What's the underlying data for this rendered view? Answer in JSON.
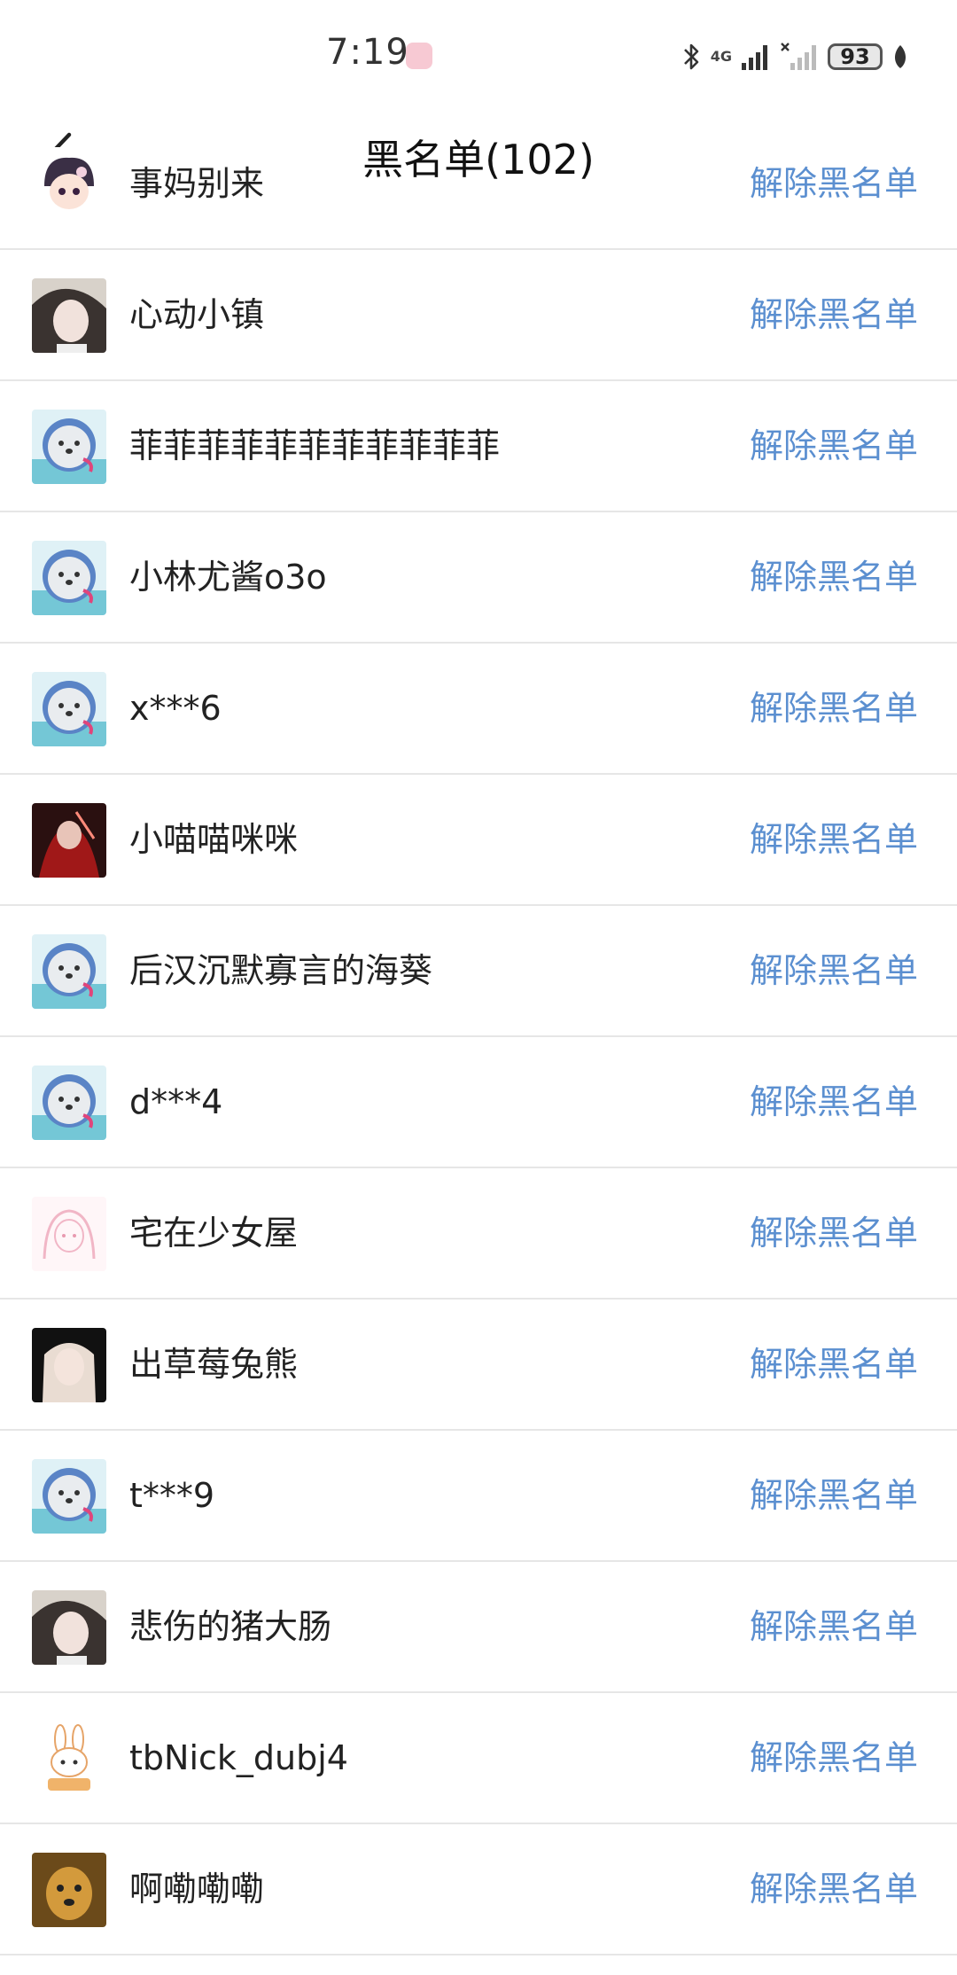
{
  "status_bar": {
    "time": "7:19",
    "network": "4G",
    "battery": "93"
  },
  "header": {
    "title": "黑名单(102)"
  },
  "action_label": "解除黑名单",
  "colors": {
    "link": "#5b8fd0",
    "divider": "#e6e6e6"
  },
  "users": [
    {
      "name": "事妈别来",
      "avatar": "anime-avatar"
    },
    {
      "name": "心动小镇",
      "avatar": "photo-avatar"
    },
    {
      "name": "菲菲菲菲菲菲菲菲菲菲菲",
      "avatar": "default-seal-avatar"
    },
    {
      "name": "小林尤酱o3o",
      "avatar": "default-seal-avatar"
    },
    {
      "name": "x***6",
      "avatar": "default-seal-avatar"
    },
    {
      "name": "小喵喵咪咪",
      "avatar": "red-art-avatar"
    },
    {
      "name": "后汉沉默寡言的海葵",
      "avatar": "default-seal-avatar"
    },
    {
      "name": "d***4",
      "avatar": "default-seal-avatar"
    },
    {
      "name": "宅在少女屋",
      "avatar": "pink-sketch-avatar"
    },
    {
      "name": "出草莓兔熊",
      "avatar": "photo-avatar-dark"
    },
    {
      "name": "t***9",
      "avatar": "default-seal-avatar"
    },
    {
      "name": "悲伤的猪大肠",
      "avatar": "photo-avatar"
    },
    {
      "name": "tbNick_dubj4",
      "avatar": "bunny-avatar"
    },
    {
      "name": "啊嘞嘞嘞",
      "avatar": "dog-avatar"
    }
  ]
}
